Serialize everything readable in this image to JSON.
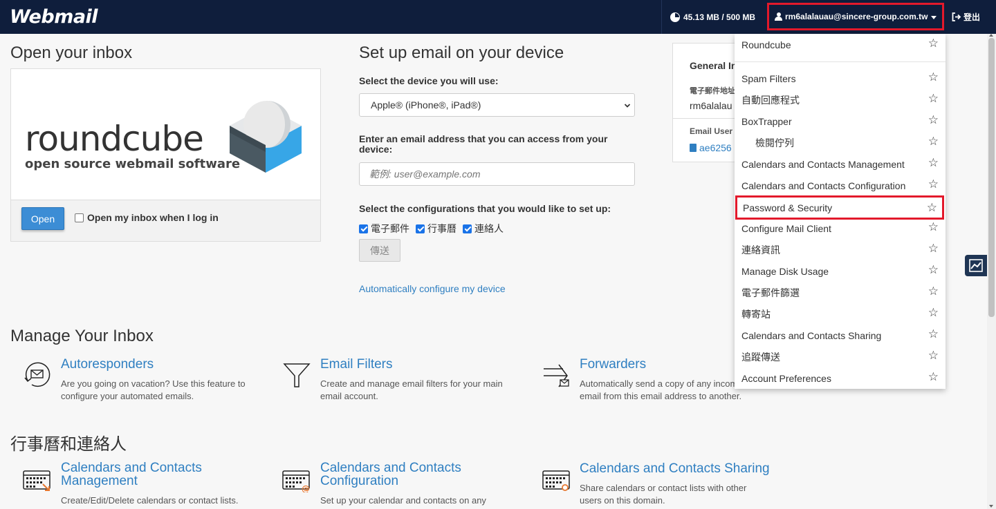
{
  "header": {
    "logo_text": "Webmail",
    "disk_usage": "45.13 MB / 500 MB",
    "user_email": "rm6alalauau@sincere-group.com.tw",
    "logout_label": "登出"
  },
  "open_inbox": {
    "title": "Open your inbox",
    "logo_word": "roundcube",
    "logo_tagline": "open source webmail software",
    "open_button": "Open",
    "auto_open_label": "Open my inbox when I log in"
  },
  "setup": {
    "title": "Set up email on your device",
    "device_label": "Select the device you will use:",
    "device_selected": "Apple® (iPhone®, iPad®)",
    "email_label": "Enter an email address that you can access from your device:",
    "email_placeholder": "範例: user@example.com",
    "config_label": "Select the configurations that you would like to set up:",
    "configs": [
      "電子郵件",
      "行事曆",
      "連絡人"
    ],
    "send_button": "傳送",
    "auto_config_link": "Automatically configure my device"
  },
  "general_info": {
    "title": "General In",
    "email_label": "電子郵件地址",
    "email_value": "rm6alalau",
    "user_label": "Email User",
    "user_value": "ae6256"
  },
  "menu": {
    "items": [
      {
        "label": "Roundcube"
      },
      {
        "label": "Spam Filters"
      },
      {
        "label": "自動回應程式"
      },
      {
        "label": "BoxTrapper"
      },
      {
        "label": "檢閱佇列"
      },
      {
        "label": "Calendars and Contacts Management"
      },
      {
        "label": "Calendars and Contacts Configuration"
      },
      {
        "label": "Password & Security"
      },
      {
        "label": "Configure Mail Client"
      },
      {
        "label": "連絡資訊"
      },
      {
        "label": "Manage Disk Usage"
      },
      {
        "label": "電子郵件篩選"
      },
      {
        "label": "轉寄站"
      },
      {
        "label": "Calendars and Contacts Sharing"
      },
      {
        "label": "追蹤傳送"
      },
      {
        "label": "Account Preferences"
      }
    ]
  },
  "manage": {
    "title": "Manage Your Inbox",
    "features": [
      {
        "title": "Autoresponders",
        "desc1": "Are you going on vacation? Use this feature to",
        "desc2": "configure your automated emails."
      },
      {
        "title": "Email Filters",
        "desc1": "Create and manage email filters for your main",
        "desc2": "email account."
      },
      {
        "title": "Forwarders",
        "desc1": "Automatically send a copy of any incoming",
        "desc2": "email from this email address to another."
      }
    ]
  },
  "calendars": {
    "title": "行事曆和連絡人",
    "features": [
      {
        "title1": "Calendars and Contacts",
        "title2": "Management",
        "desc1": "Create/Edit/Delete calendars or contact lists."
      },
      {
        "title1": "Calendars and Contacts",
        "title2": "Configuration",
        "desc1": "Set up your calendar and contacts on any"
      },
      {
        "title1": "Calendars and Contacts Sharing",
        "desc1": "Share calendars or contact lists with other",
        "desc2": "users on this domain."
      }
    ]
  },
  "colors": {
    "topbar": "#0f1e3c",
    "link": "#2f7fc1",
    "highlight": "#e3192b",
    "primary_button": "#3c8dd5"
  }
}
